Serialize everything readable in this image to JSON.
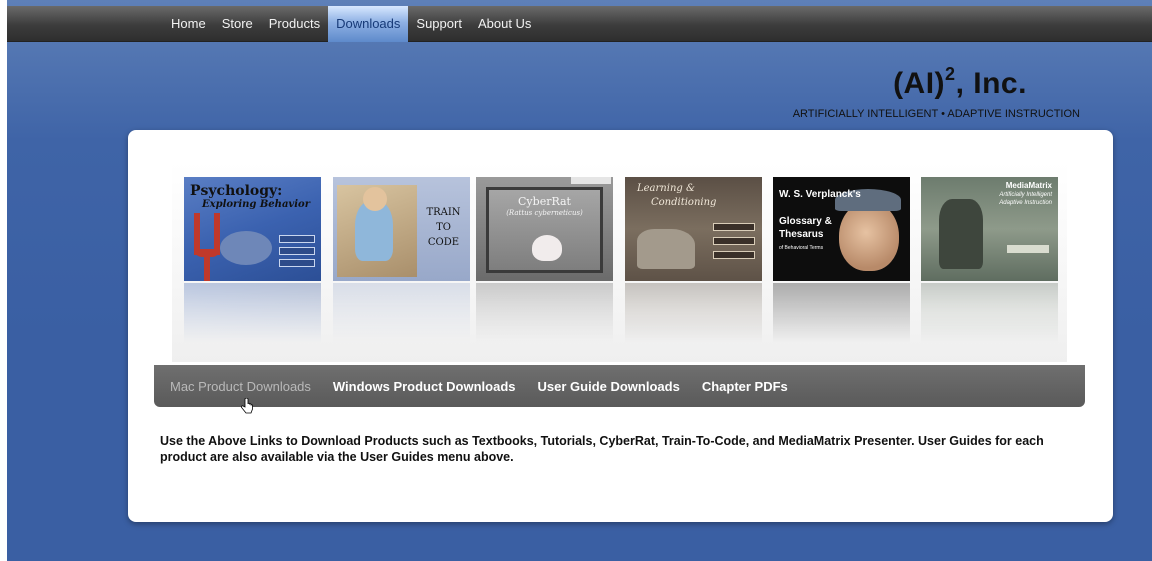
{
  "nav": {
    "items": [
      {
        "label": "Home"
      },
      {
        "label": "Store"
      },
      {
        "label": "Products"
      },
      {
        "label": "Downloads",
        "active": true
      },
      {
        "label": "Support"
      },
      {
        "label": "About Us"
      }
    ]
  },
  "brand": {
    "title_main": "(AI)",
    "title_sup": "2",
    "title_rest": ", Inc.",
    "subtitle": "ARTIFICIALLY INTELLIGENT • ADAPTIVE INSTRUCTION"
  },
  "covers": [
    {
      "title": "Psychology:",
      "subtitle": "Exploring Behavior"
    },
    {
      "line1": "TRAIN",
      "line2": "TO",
      "line3": "CODE"
    },
    {
      "title": "CyberRat",
      "subtitle": "(Rattus cyberneticus)"
    },
    {
      "line1": "Learning &",
      "line2": "Conditioning"
    },
    {
      "line1": "W. S. Verplanck's",
      "line2": "Glossary &",
      "line3": "Thesarus",
      "line4": "of Behavioral Terms"
    },
    {
      "title": "MediaMatrix",
      "subtitle": "Artificially Intelligent Adaptive Instruction"
    }
  ],
  "subnav": {
    "items": [
      {
        "label": "Mac Product Downloads"
      },
      {
        "label": "Windows Product Downloads"
      },
      {
        "label": "User Guide Downloads"
      },
      {
        "label": "Chapter PDFs"
      }
    ]
  },
  "description": "Use the Above Links to Download Products such as Textbooks, Tutorials, CyberRat, Train-To-Code, and MediaMatrix Presenter. User Guides for each product are also available via the User Guides menu above.",
  "colors": {
    "background": "#3a5fa3",
    "navbar": "#3c3c3c",
    "active_tab": "#8fb1e4",
    "subnav": "#636363"
  }
}
